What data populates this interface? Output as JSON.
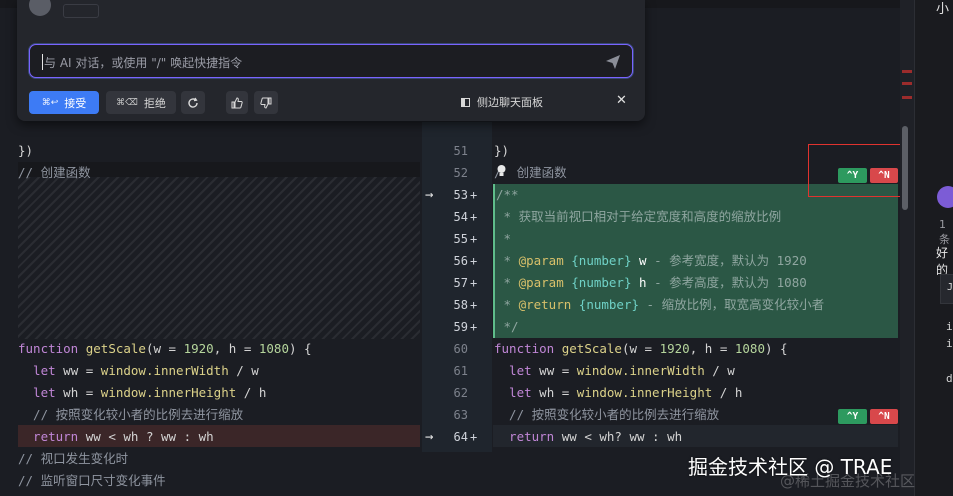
{
  "ai_panel": {
    "input_placeholder": "与 AI 对话，或使用 \"/\" 唤起快捷指令",
    "accept": {
      "shortcut": "⌘↩",
      "label": "接受"
    },
    "reject": {
      "shortcut": "⌘⌫",
      "label": "拒绝"
    },
    "side_panel_label": "侧边聊天面板",
    "close": "✕"
  },
  "left_code": {
    "l51": "})",
    "l52": "// 创建函数",
    "l60": {
      "kw": "function",
      "fn": "getScale",
      "p1": "(w = ",
      "n1": "1920",
      "p2": ", h = ",
      "n2": "1080",
      "p3": ") {"
    },
    "l61": {
      "kw": "  let",
      "rest": " ww = ",
      "obj": "window.innerWidth",
      "tail": " / w"
    },
    "l62": {
      "kw": "  let",
      "rest": " wh = ",
      "obj": "window.innerHeight",
      "tail": " / h"
    },
    "l63": "  // 按照变化较小者的比例去进行缩放",
    "l64": {
      "kw": "  return",
      "rest": " ww < wh ? ww : wh"
    },
    "l65": "// 视口发生变化时",
    "l66": "// 监听窗口尺寸变化事件"
  },
  "right_code": {
    "l51": "})",
    "l52": "/  创建函数",
    "l53": "/**",
    "l54": " * 获取当前视口相对于给定宽度和高度的缩放比例",
    "l55": " *",
    "l56": {
      "star": " * ",
      "tag": "@param",
      "type": "{number}",
      "name": " w",
      "desc": " - 参考宽度，默认为 1920"
    },
    "l57": {
      "star": " * ",
      "tag": "@param",
      "type": "{number}",
      "name": " h",
      "desc": " - 参考高度，默认为 1080"
    },
    "l58": {
      "star": " * ",
      "tag": "@return",
      "type": "{number}",
      "desc": " - 缩放比例，取宽高变化较小者"
    },
    "l59": " */",
    "l60": {
      "kw": "function",
      "fn": "getScale",
      "p1": "(w = ",
      "n1": "1920",
      "p2": ", h = ",
      "n2": "1080",
      "p3": ") {"
    },
    "l61": {
      "kw": "  let",
      "rest": " ww = ",
      "obj": "window.innerWidth",
      "tail": " / w"
    },
    "l62": {
      "kw": "  let",
      "rest": " wh = ",
      "obj": "window.innerHeight",
      "tail": " / h"
    },
    "l63": "  // 按照变化较小者的比例去进行缩放",
    "l64": {
      "kw": "  return",
      "rest": " ww < wh? ww : wh"
    }
  },
  "line_numbers": [
    "51",
    "52",
    "53",
    "54",
    "55",
    "56",
    "57",
    "58",
    "59",
    "60",
    "61",
    "62",
    "63",
    "64"
  ],
  "added_marker": "+",
  "chips": {
    "accept": "^Y",
    "reject": "^N"
  },
  "right_panel": {
    "char1": "小",
    "text1": "1 条",
    "text2": "好的",
    "j": "J",
    "i1": "i",
    "i2": "i",
    "d": "d"
  },
  "watermark": "掘金技术社区 @ TRAE",
  "watermark2": "@稀土掘金技术社区",
  "colors": {
    "accent": "#3d7bf5",
    "added_bg": "#2b5745",
    "deleted_bg": "#3b2628",
    "chip_accept": "#2d9a5f",
    "chip_reject": "#d8484b",
    "highlight": "#e0332f"
  }
}
